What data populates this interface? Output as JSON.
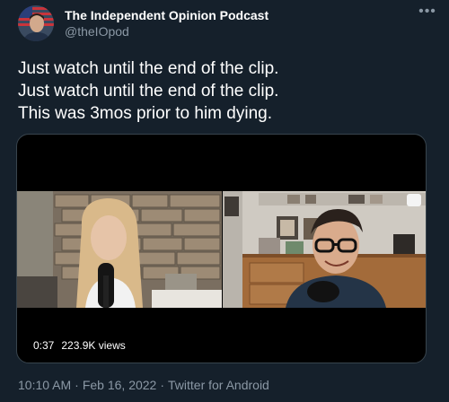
{
  "author": {
    "name": "The Independent Opinion Podcast",
    "handle": "@theIOpod",
    "avatar_icon": "profile-photo-with-flag"
  },
  "menu_icon": "more-horizontal-icon",
  "tweet": {
    "lines": [
      "Just watch until the end of the clip.",
      "Just watch until the end of the clip.",
      "This was 3mos prior to him dying."
    ]
  },
  "video": {
    "duration": "0:37",
    "views": "223.9K views"
  },
  "footer": {
    "time": "10:10 AM",
    "date": "Feb 16, 2022",
    "source": "Twitter for Android",
    "separator": "·"
  },
  "colors": {
    "background": "#15202b",
    "text_primary": "#ffffff",
    "text_secondary": "#8b98a5",
    "border": "#38444d"
  }
}
